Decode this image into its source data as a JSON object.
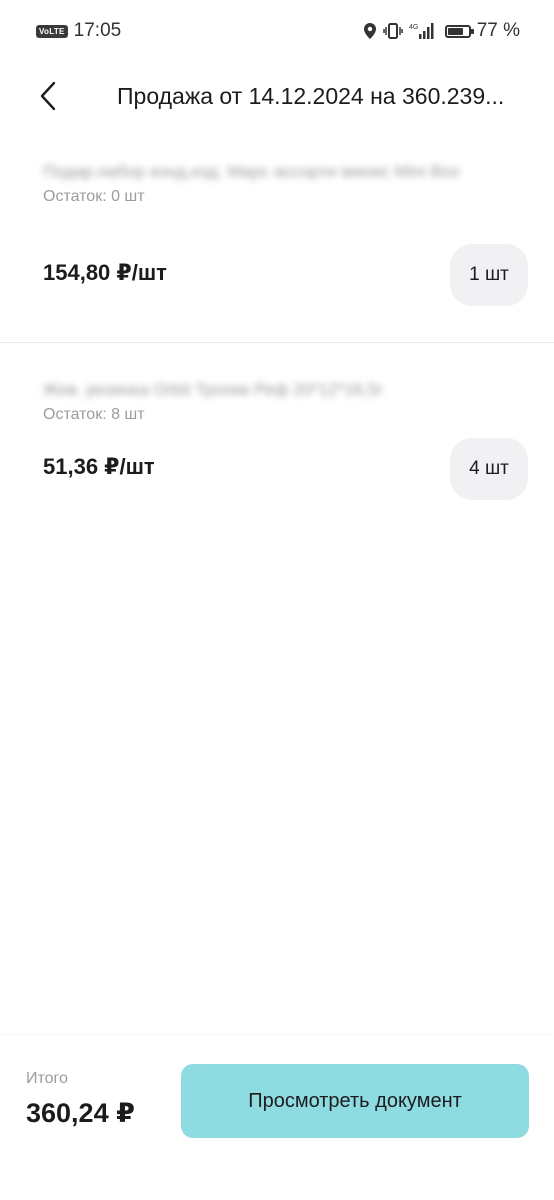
{
  "status_bar": {
    "volte": "VoLTE",
    "time": "17:05",
    "network": "4G",
    "battery_text": "77 %",
    "battery_level": 0.77,
    "icons": [
      "location-icon",
      "vibrate-icon",
      "signal-icon",
      "battery-icon"
    ]
  },
  "header": {
    "back_icon": "chevron-left-icon",
    "title": "Продажа от 14.12.2024 на 360.239..."
  },
  "items": [
    {
      "name": "Подар.набор конд.изд. Марс ассорти минис Mini Box",
      "stock": "Остаток: 0 шт",
      "price": "154,80 ₽/шт",
      "quantity": "1 шт"
    },
    {
      "name": "Жев. резинка Orbit Тропик Реф 20*12*16,5г",
      "stock": "Остаток: 8 шт",
      "price": "51,36 ₽/шт",
      "quantity": "4 шт"
    }
  ],
  "footer": {
    "total_label": "Итого",
    "total_value": "360,24 ₽",
    "view_button": "Просмотреть документ",
    "button_color": "#8fdbe2"
  }
}
